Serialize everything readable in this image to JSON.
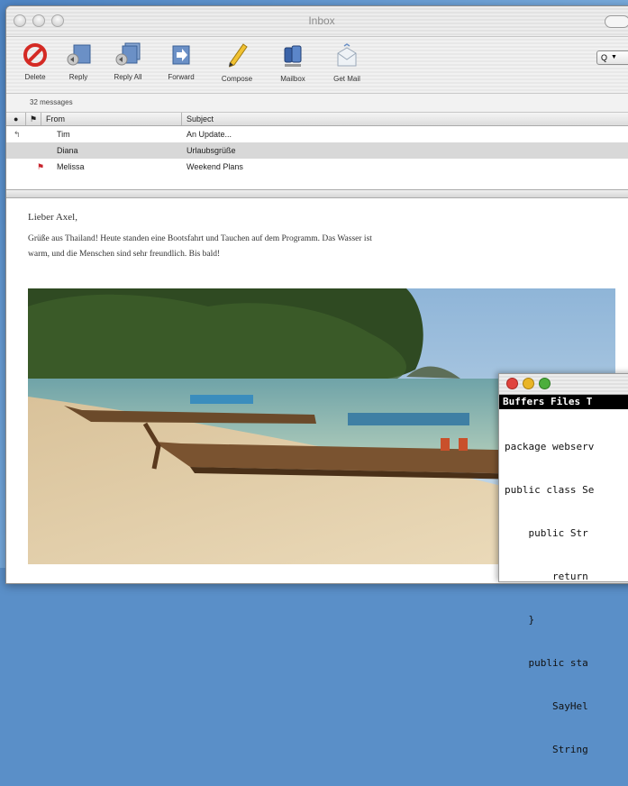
{
  "window": {
    "title": "Inbox"
  },
  "toolbar": {
    "buttons": [
      {
        "label": "Delete",
        "icon": "delete-icon"
      },
      {
        "label": "Reply",
        "icon": "reply-icon"
      },
      {
        "label": "Reply All",
        "icon": "reply-all-icon"
      },
      {
        "label": "Forward",
        "icon": "forward-icon"
      },
      {
        "label": "Compose",
        "icon": "compose-icon"
      },
      {
        "label": "Mailbox",
        "icon": "mailbox-icon"
      },
      {
        "label": "Get Mail",
        "icon": "get-mail-icon"
      }
    ],
    "search_glyph": "Q",
    "search_arrow": "▼"
  },
  "message_count": "32 messages",
  "columns": {
    "status": "●",
    "flag": "⚑",
    "from": "From",
    "subject": "Subject"
  },
  "messages": [
    {
      "status": "↰",
      "from": "Tim",
      "subject": "An Update...",
      "flagged": false
    },
    {
      "status": "",
      "from": "Diana",
      "subject": "Urlaubsgrüße",
      "flagged": false,
      "selected": true
    },
    {
      "status": "",
      "from": "Melissa",
      "subject": "Weekend Plans",
      "flagged": true
    }
  ],
  "message_body": {
    "greeting": "Lieber Axel,",
    "paragraph": "Grüße aus Thailand! Heute standen eine Bootsfahrt und Tauchen auf dem Programm. Das Wasser ist warm, und die Menschen sind sehr freundlich. Bis bald!",
    "image": "beach-longtail-boats-photo"
  },
  "terminal": {
    "menubar": "Buffers Files T",
    "lines": [
      "package webserv",
      "public class Se",
      "    public Str",
      "        return",
      "    }",
      "    public sta",
      "        SayHel",
      "        String"
    ]
  },
  "colors": {
    "flag_red": "#c8232c",
    "close_red": "#e0443e",
    "min_yellow": "#e9b526",
    "zoom_green": "#4cae3c"
  }
}
